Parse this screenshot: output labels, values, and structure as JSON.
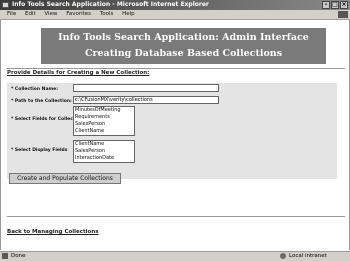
{
  "window": {
    "title": "Info Tools Search Application - Microsoft Internet Explorer"
  },
  "menu": [
    "File",
    "Edit",
    "View",
    "Favorites",
    "Tools",
    "Help"
  ],
  "header": {
    "line1": "Info Tools Search Application: Admin Interface",
    "line2": "Creating Database Based Collections"
  },
  "section_title": "Provide Details for Creating a New Collection:",
  "form": {
    "collection_name_label": "* Collection Name:",
    "collection_name_value": "",
    "path_label": "* Path to the Collection:",
    "path_value": "c:\\CFusionMX\\verity\\collections",
    "select_fields_label": "* Select Fields for Collection:",
    "fields_options": [
      "MinutesOfMeeting",
      "Requirements",
      "SalesPerson",
      "ClientName"
    ],
    "display_fields_label": "* Select Display Fields",
    "display_options": [
      "ClientName",
      "SalesPerson",
      "InteractionDate"
    ],
    "submit_label": "Create and Populate Collections"
  },
  "back_link": "Back to Managing Collections",
  "status": {
    "left": "Done",
    "zone": "Local intranet"
  }
}
